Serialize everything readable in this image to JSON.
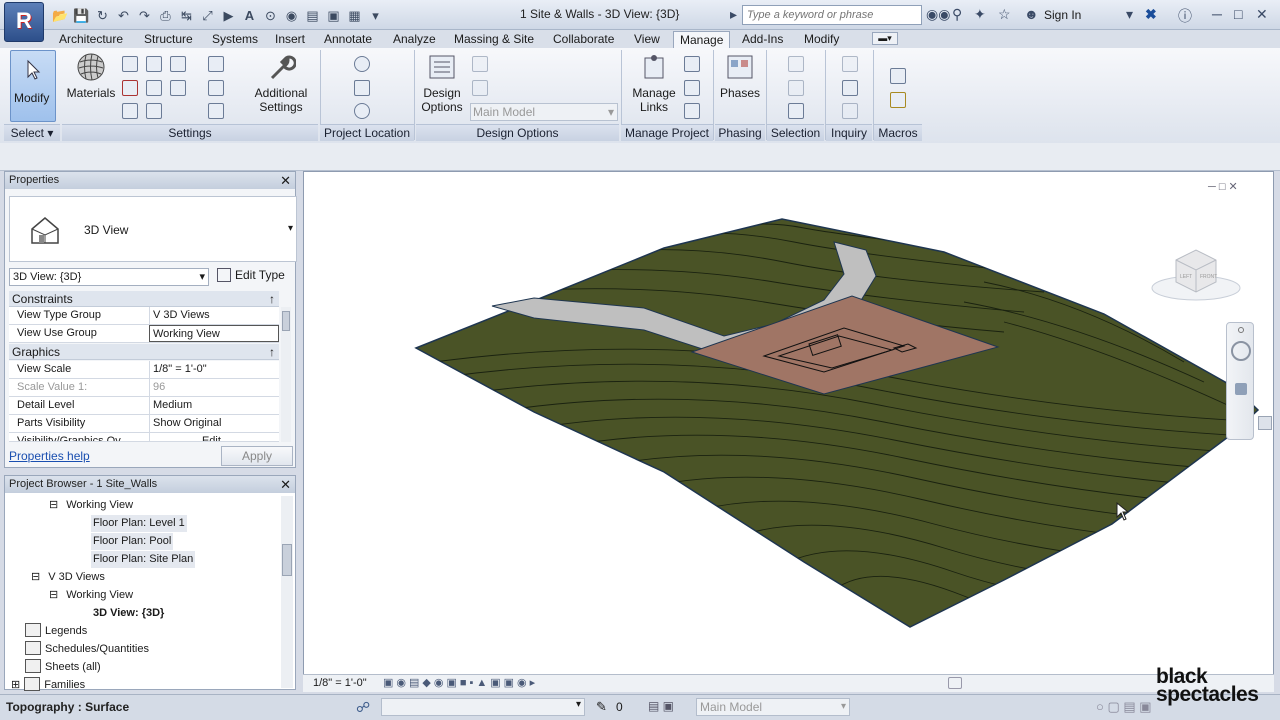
{
  "app": {
    "logo_letter": "R",
    "document_title": "1 Site & Walls - 3D View: {3D}"
  },
  "search": {
    "placeholder": "Type a keyword or phrase"
  },
  "account": {
    "sign_in_label": "Sign In"
  },
  "ribbon_tabs": [
    "Architecture",
    "Structure",
    "Systems",
    "Insert",
    "Annotate",
    "Analyze",
    "Massing & Site",
    "Collaborate",
    "View",
    "Manage",
    "Add-Ins",
    "Modify"
  ],
  "active_tab": "Manage",
  "ribbon": {
    "modify_label": "Modify",
    "materials_label": "Materials",
    "additional_settings_label": "Additional\nSettings",
    "design_options_label": "Design\nOptions",
    "main_model_dropdown": "Main Model",
    "manage_links_label": "Manage\nLinks",
    "phases_label": "Phases",
    "panels": [
      "Select",
      "Settings",
      "Project Location",
      "Design Options",
      "Manage Project",
      "Phasing",
      "Selection",
      "Inquiry",
      "Macros"
    ]
  },
  "properties": {
    "title": "Properties",
    "type_name": "3D View",
    "instance_selector": "3D View: {3D}",
    "edit_type_label": "Edit Type",
    "sections": {
      "constraints": "Constraints",
      "graphics": "Graphics"
    },
    "rows": [
      {
        "key": "View Type Group",
        "value": "V 3D Views"
      },
      {
        "key": "View Use Group",
        "value": "Working View"
      },
      {
        "key": "View Scale",
        "value": "1/8\" = 1'-0\""
      },
      {
        "key": "Scale Value    1:",
        "value": "96"
      },
      {
        "key": "Detail Level",
        "value": "Medium"
      },
      {
        "key": "Parts Visibility",
        "value": "Show Original"
      },
      {
        "key": "Visibility/Graphics Ov...",
        "value": "Edit..."
      }
    ],
    "help_link": "Properties help",
    "apply_label": "Apply"
  },
  "browser": {
    "title": "Project Browser - 1 Site_Walls",
    "items": [
      {
        "label": "Working View",
        "indent": 3
      },
      {
        "label": "Floor Plan: Level 1",
        "indent": 5
      },
      {
        "label": "Floor Plan: Pool",
        "indent": 5
      },
      {
        "label": "Floor Plan: Site Plan",
        "indent": 5
      },
      {
        "label": "V 3D Views",
        "indent": 2
      },
      {
        "label": "Working View",
        "indent": 3
      },
      {
        "label": "3D View: {3D}",
        "indent": 5
      },
      {
        "label": "Legends",
        "indent": 1
      },
      {
        "label": "Schedules/Quantities",
        "indent": 1
      },
      {
        "label": "Sheets (all)",
        "indent": 1
      },
      {
        "label": "Families",
        "indent": 1
      }
    ]
  },
  "viewbar": {
    "scale": "1/8\" = 1'-0\""
  },
  "status": {
    "text": "Topography : Surface",
    "model_selector": "Main Model",
    "zero_count": "0"
  },
  "watermark": {
    "line1": "black",
    "line2": "spectacles"
  },
  "colors": {
    "terrain": "#4a5326",
    "road": "#bfbfbf",
    "pad": "#a07565",
    "ribbon_active": "#9fc1ec"
  }
}
